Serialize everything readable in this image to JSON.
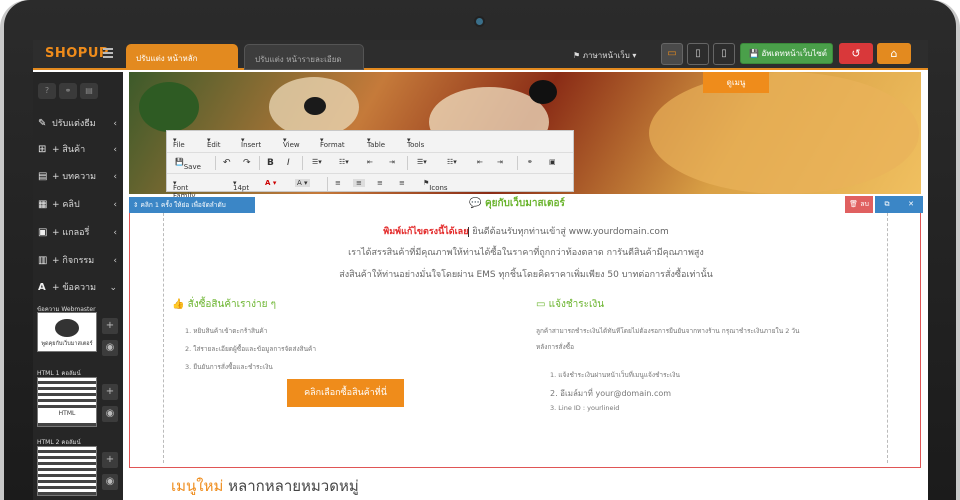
{
  "topbar": {
    "logo": "SHOPUP",
    "tab_active": "ปรับแต่ง หน้าหลัก",
    "tab_inactive": "ปรับแต่ง หน้ารายละเอียด",
    "language": "ภาษาหน้าเว็บ",
    "publish_label": "อัพเดทหน้าเว็บไซต์"
  },
  "sidebar": {
    "items": [
      {
        "icon": "edit-icon",
        "label": "ปรับแต่งธีม"
      },
      {
        "icon": "gift-icon",
        "label": "+ สินค้า"
      },
      {
        "icon": "document-icon",
        "label": "+ บทความ"
      },
      {
        "icon": "film-icon",
        "label": "+ คลิป"
      },
      {
        "icon": "image-icon",
        "label": "+ แกลอรี่"
      },
      {
        "icon": "calendar-icon",
        "label": "+ กิจกรรม"
      },
      {
        "icon": "text-icon",
        "label": "+ ข้อความ"
      }
    ],
    "thumbs": [
      {
        "title": "ข้อความ Webmaster",
        "caption": "พูดคุยกับเว็บมาสเตอร์"
      },
      {
        "title": "HTML 1 คอลัมน์",
        "caption": "HTML"
      },
      {
        "title": "HTML 2 คอลัมน์",
        "caption": ""
      }
    ]
  },
  "banner": {
    "button_label": "ดูเมนู"
  },
  "toolbar": {
    "menus": [
      "File",
      "Edit",
      "Insert",
      "View",
      "Format",
      "Table",
      "Tools"
    ],
    "save_label": "Save",
    "font_family": "Font Family",
    "font_size": "14pt",
    "icons_label": "Icons"
  },
  "editor": {
    "edit_hint": "คลิก 1 ครั้ง ให้ย่อ เพื่อจัดลำดับ",
    "chat_title": "คุยกับเว็บมาสเตอร์",
    "delete_label": "ลบ",
    "intro_red": "พิมพ์แก้ไขตรงนี้ได้เลย",
    "intro_line1_rest": " ยินดีต้อนรับทุกท่านเข้าสู่ www.yourdomain.com",
    "intro_line2": "เราได้สรรสินค้าที่มีคุณภาพให้ท่านได้ซื้อในราคาที่ถูกกว่าท้องตลาด การันตีสินค้ามีคุณภาพสูง",
    "intro_line3": "ส่งสินค้าให้ท่านอย่างมั่นใจโดยผ่าน EMS ทุกชิ้นโดยคิดราคาเพิ่มเพียง 50 บาทต่อการสั่งซื้อเท่านั้น",
    "left_title": "สั่งซื้อสินค้าเราง่าย ๆ",
    "left_steps": [
      "1.  หยิบสินค้าเข้าตะกร้าสินค้า",
      "2.  ใส่รายละเอียดผู้ซื้อและข้อมูลการจัดส่งสินค้า",
      "3.  ยืนยันการสั่งซื้อและชำระเงิน"
    ],
    "order_button": "คลิกเลือกซื้อสินค้าที่นี่",
    "right_title": "แจ้งชำระเงิน",
    "right_desc_1": "ลูกค้าสามารถชำระเงินได้ทันทีโดยไม่ต้องรอการยืนยันจากทางร้าน กรุณาชำระเงินภายใน 2 วัน",
    "right_desc_2": "หลังการสั่งซื้อ",
    "right_steps": [
      "1.  แจ้งชำระเงินผ่านหน้าเว็บที่เมนูแจ้งชำระเงิน",
      "2.  อีเมล์มาที่ your@domain.com",
      "3.  Line ID : yourlineid"
    ]
  },
  "section": {
    "accent": "เมนูใหม่",
    "rest": "หลากหลายหมวดหมู่"
  }
}
